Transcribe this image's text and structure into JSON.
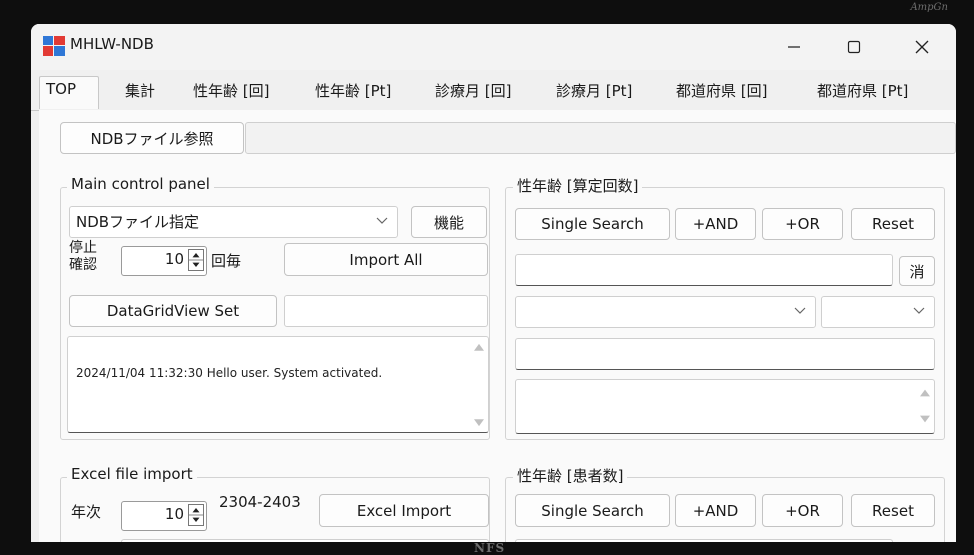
{
  "watermarks": {
    "top": "AmpGn",
    "bottom": "NFS"
  },
  "window": {
    "title": "MHLW-NDB"
  },
  "tabs": [
    {
      "label": "TOP"
    },
    {
      "label": "集計"
    },
    {
      "label": "性年齢 [回]"
    },
    {
      "label": "性年齢 [Pt]"
    },
    {
      "label": "診療月 [回]"
    },
    {
      "label": "診療月 [Pt]"
    },
    {
      "label": "都道府県 [回]"
    },
    {
      "label": "都道府県 [Pt]"
    }
  ],
  "browse_button": "NDBファイル参照",
  "main_panel": {
    "legend": "Main control panel",
    "ndb_file_select": "NDBファイル指定",
    "function_button": "機能",
    "stop_confirm_label": "停止\n確認",
    "interval_value": "10",
    "interval_unit": "回毎",
    "import_all_button": "Import All",
    "datagridview_button": "DataGridView Set",
    "log_text": "2024/11/04 11:32:30 Hello user. System activated."
  },
  "sex_age_count_panel": {
    "legend": "性年齢 [算定回数]",
    "single_search": "Single Search",
    "and_button": "+AND",
    "or_button": "+OR",
    "reset_button": "Reset",
    "clear_button": "消"
  },
  "excel_panel": {
    "legend": "Excel file import",
    "year_label": "年次",
    "year_value": "10",
    "range_text": "2304-2403",
    "import_button": "Excel Import"
  },
  "sex_age_patients_panel": {
    "legend": "性年齢 [患者数]",
    "single_search": "Single Search",
    "and_button": "+AND",
    "or_button": "+OR",
    "reset_button": "Reset"
  }
}
